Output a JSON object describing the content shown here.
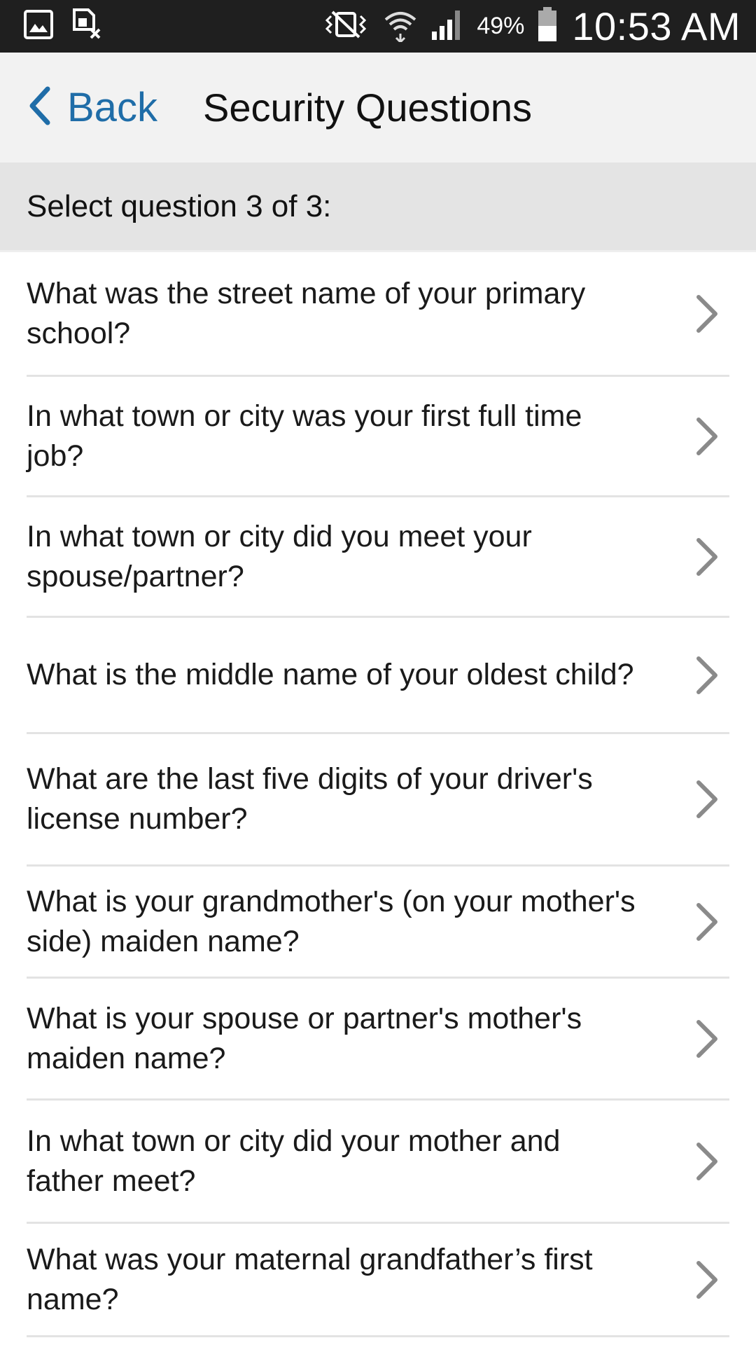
{
  "status_bar": {
    "battery_percent": "49%",
    "time": "10:53 AM",
    "icons": [
      "gallery-icon",
      "sim-blocked-icon",
      "vibrate-mute-icon",
      "wifi-icon",
      "signal-icon",
      "battery-icon"
    ]
  },
  "header": {
    "back_label": "Back",
    "title": "Security Questions",
    "accent_color": "#1f6da8"
  },
  "subheader": {
    "text": "Select question 3 of 3:"
  },
  "questions": [
    "What was the street name of your primary school?",
    "In what town or city was your first full time job?",
    "In what town or city did you meet your spouse/partner?",
    "What is the middle name of your oldest child?",
    "What are the last five digits of your driver's license number?",
    "What is your grandmother's (on your mother's side) maiden name?",
    "What is your spouse or partner's mother's maiden name?",
    "In what town or city did your mother and father meet?",
    "What was your maternal grandfather’s first name?"
  ]
}
